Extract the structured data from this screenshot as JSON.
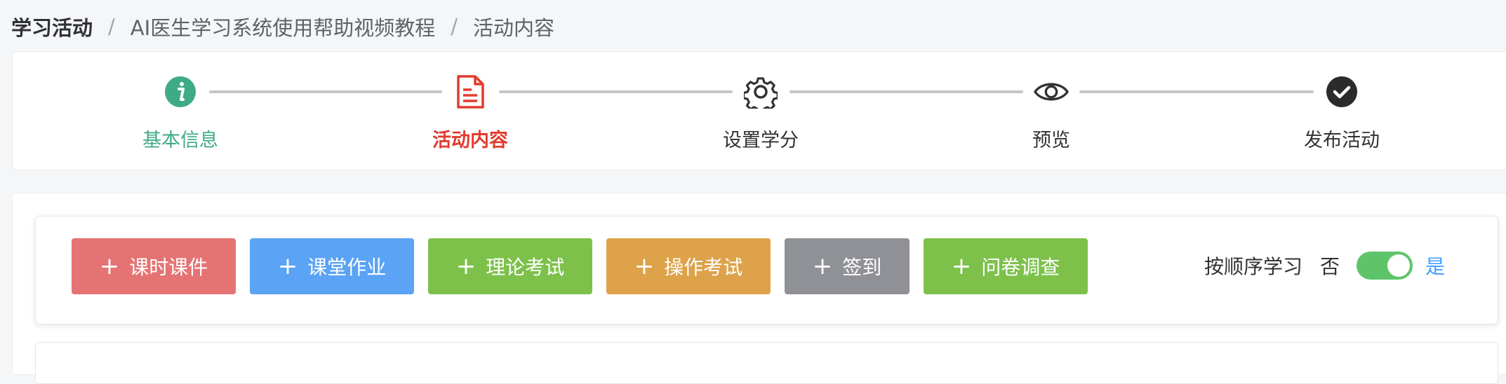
{
  "breadcrumb": {
    "root": "学习活动",
    "middle": "AI医生学习系统使用帮助视频教程",
    "current": "活动内容",
    "separator": "/"
  },
  "steps": [
    {
      "label": "基本信息",
      "state": "done",
      "icon": "info-circle-icon"
    },
    {
      "label": "活动内容",
      "state": "active",
      "icon": "document-icon"
    },
    {
      "label": "设置学分",
      "state": "pending",
      "icon": "gear-icon"
    },
    {
      "label": "预览",
      "state": "pending",
      "icon": "eye-icon"
    },
    {
      "label": "发布活动",
      "state": "pending",
      "icon": "check-circle-icon"
    }
  ],
  "toolbar": {
    "buttons": [
      {
        "label": "课时课件",
        "color": "#e57373"
      },
      {
        "label": "课堂作业",
        "color": "#5aa3f5"
      },
      {
        "label": "理论考试",
        "color": "#7dc14b"
      },
      {
        "label": "操作考试",
        "color": "#dda24a"
      },
      {
        "label": "签到",
        "color": "#8f9196"
      },
      {
        "label": "问卷调查",
        "color": "#7dc14b"
      }
    ],
    "plus": "+",
    "order_label": "按顺序学习",
    "option_no": "否",
    "option_yes": "是",
    "order_enabled": true
  },
  "colors": {
    "done": "#3faa86",
    "active": "#e23b2e",
    "toggle_on": "#5ec46a",
    "link": "#409eff"
  }
}
